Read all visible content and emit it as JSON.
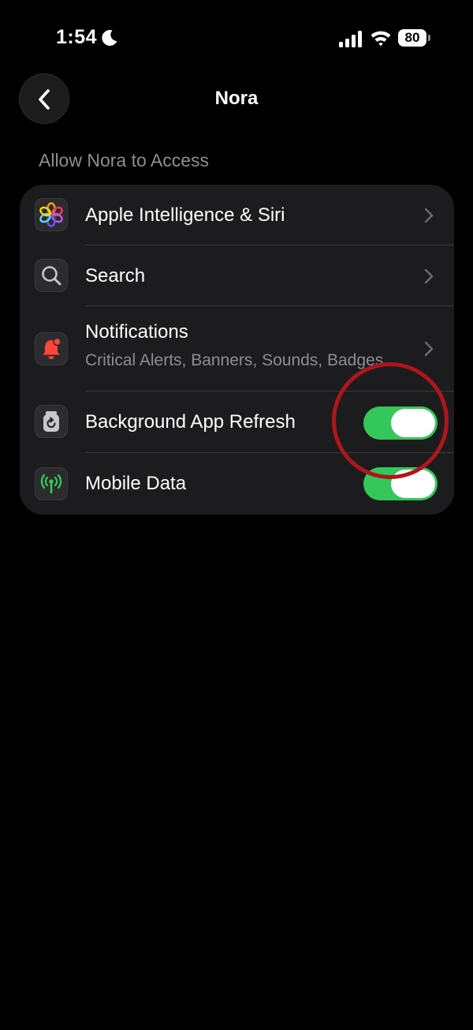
{
  "status_bar": {
    "time": "1:54",
    "battery_level": "80",
    "icons": [
      "moon-icon",
      "cellular-signal-icon",
      "wifi-icon",
      "battery-icon"
    ]
  },
  "nav": {
    "back_icon": "chevron-left-icon",
    "title": "Nora"
  },
  "section": {
    "header": "Allow Nora to Access",
    "rows": [
      {
        "label": "Apple Intelligence & Siri",
        "icon": "apple-intelligence-icon",
        "accessory": "chevron"
      },
      {
        "label": "Search",
        "icon": "search-icon",
        "accessory": "chevron"
      },
      {
        "label": "Notifications",
        "sublabel": "Critical Alerts, Banners, Sounds, Badges",
        "icon": "notification-bell-icon",
        "accessory": "chevron"
      },
      {
        "label": "Background App Refresh",
        "icon": "background-refresh-icon",
        "accessory": "toggle",
        "toggle_on": true
      },
      {
        "label": "Mobile Data",
        "icon": "antenna-icon",
        "accessory": "toggle",
        "toggle_on": true
      }
    ]
  },
  "colors": {
    "background": "#000000",
    "card": "#1c1c1e",
    "toggle_on": "#34c759",
    "secondary_text": "#8d8d93",
    "annotation": "#b0151c"
  }
}
